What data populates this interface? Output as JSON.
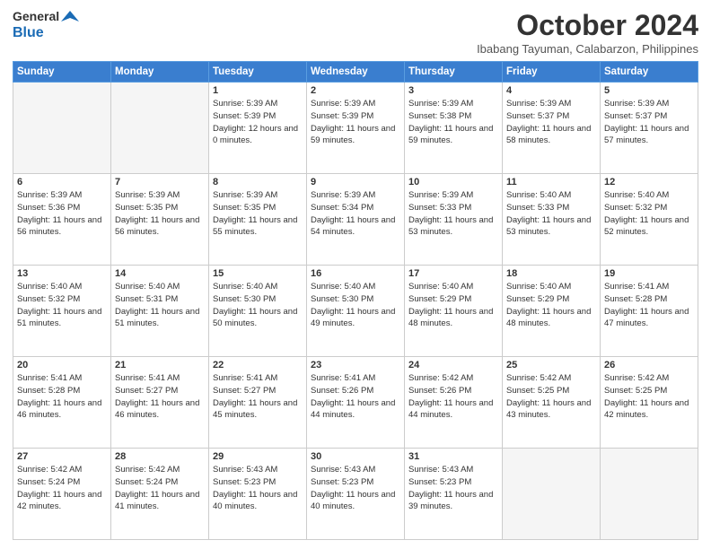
{
  "header": {
    "logo_general": "General",
    "logo_blue": "Blue",
    "month_title": "October 2024",
    "location": "Ibabang Tayuman, Calabarzon, Philippines"
  },
  "days_of_week": [
    "Sunday",
    "Monday",
    "Tuesday",
    "Wednesday",
    "Thursday",
    "Friday",
    "Saturday"
  ],
  "weeks": [
    [
      {
        "day": "",
        "sunrise": "",
        "sunset": "",
        "daylight": ""
      },
      {
        "day": "",
        "sunrise": "",
        "sunset": "",
        "daylight": ""
      },
      {
        "day": "1",
        "sunrise": "Sunrise: 5:39 AM",
        "sunset": "Sunset: 5:39 PM",
        "daylight": "Daylight: 12 hours and 0 minutes."
      },
      {
        "day": "2",
        "sunrise": "Sunrise: 5:39 AM",
        "sunset": "Sunset: 5:39 PM",
        "daylight": "Daylight: 11 hours and 59 minutes."
      },
      {
        "day": "3",
        "sunrise": "Sunrise: 5:39 AM",
        "sunset": "Sunset: 5:38 PM",
        "daylight": "Daylight: 11 hours and 59 minutes."
      },
      {
        "day": "4",
        "sunrise": "Sunrise: 5:39 AM",
        "sunset": "Sunset: 5:37 PM",
        "daylight": "Daylight: 11 hours and 58 minutes."
      },
      {
        "day": "5",
        "sunrise": "Sunrise: 5:39 AM",
        "sunset": "Sunset: 5:37 PM",
        "daylight": "Daylight: 11 hours and 57 minutes."
      }
    ],
    [
      {
        "day": "6",
        "sunrise": "Sunrise: 5:39 AM",
        "sunset": "Sunset: 5:36 PM",
        "daylight": "Daylight: 11 hours and 56 minutes."
      },
      {
        "day": "7",
        "sunrise": "Sunrise: 5:39 AM",
        "sunset": "Sunset: 5:35 PM",
        "daylight": "Daylight: 11 hours and 56 minutes."
      },
      {
        "day": "8",
        "sunrise": "Sunrise: 5:39 AM",
        "sunset": "Sunset: 5:35 PM",
        "daylight": "Daylight: 11 hours and 55 minutes."
      },
      {
        "day": "9",
        "sunrise": "Sunrise: 5:39 AM",
        "sunset": "Sunset: 5:34 PM",
        "daylight": "Daylight: 11 hours and 54 minutes."
      },
      {
        "day": "10",
        "sunrise": "Sunrise: 5:39 AM",
        "sunset": "Sunset: 5:33 PM",
        "daylight": "Daylight: 11 hours and 53 minutes."
      },
      {
        "day": "11",
        "sunrise": "Sunrise: 5:40 AM",
        "sunset": "Sunset: 5:33 PM",
        "daylight": "Daylight: 11 hours and 53 minutes."
      },
      {
        "day": "12",
        "sunrise": "Sunrise: 5:40 AM",
        "sunset": "Sunset: 5:32 PM",
        "daylight": "Daylight: 11 hours and 52 minutes."
      }
    ],
    [
      {
        "day": "13",
        "sunrise": "Sunrise: 5:40 AM",
        "sunset": "Sunset: 5:32 PM",
        "daylight": "Daylight: 11 hours and 51 minutes."
      },
      {
        "day": "14",
        "sunrise": "Sunrise: 5:40 AM",
        "sunset": "Sunset: 5:31 PM",
        "daylight": "Daylight: 11 hours and 51 minutes."
      },
      {
        "day": "15",
        "sunrise": "Sunrise: 5:40 AM",
        "sunset": "Sunset: 5:30 PM",
        "daylight": "Daylight: 11 hours and 50 minutes."
      },
      {
        "day": "16",
        "sunrise": "Sunrise: 5:40 AM",
        "sunset": "Sunset: 5:30 PM",
        "daylight": "Daylight: 11 hours and 49 minutes."
      },
      {
        "day": "17",
        "sunrise": "Sunrise: 5:40 AM",
        "sunset": "Sunset: 5:29 PM",
        "daylight": "Daylight: 11 hours and 48 minutes."
      },
      {
        "day": "18",
        "sunrise": "Sunrise: 5:40 AM",
        "sunset": "Sunset: 5:29 PM",
        "daylight": "Daylight: 11 hours and 48 minutes."
      },
      {
        "day": "19",
        "sunrise": "Sunrise: 5:41 AM",
        "sunset": "Sunset: 5:28 PM",
        "daylight": "Daylight: 11 hours and 47 minutes."
      }
    ],
    [
      {
        "day": "20",
        "sunrise": "Sunrise: 5:41 AM",
        "sunset": "Sunset: 5:28 PM",
        "daylight": "Daylight: 11 hours and 46 minutes."
      },
      {
        "day": "21",
        "sunrise": "Sunrise: 5:41 AM",
        "sunset": "Sunset: 5:27 PM",
        "daylight": "Daylight: 11 hours and 46 minutes."
      },
      {
        "day": "22",
        "sunrise": "Sunrise: 5:41 AM",
        "sunset": "Sunset: 5:27 PM",
        "daylight": "Daylight: 11 hours and 45 minutes."
      },
      {
        "day": "23",
        "sunrise": "Sunrise: 5:41 AM",
        "sunset": "Sunset: 5:26 PM",
        "daylight": "Daylight: 11 hours and 44 minutes."
      },
      {
        "day": "24",
        "sunrise": "Sunrise: 5:42 AM",
        "sunset": "Sunset: 5:26 PM",
        "daylight": "Daylight: 11 hours and 44 minutes."
      },
      {
        "day": "25",
        "sunrise": "Sunrise: 5:42 AM",
        "sunset": "Sunset: 5:25 PM",
        "daylight": "Daylight: 11 hours and 43 minutes."
      },
      {
        "day": "26",
        "sunrise": "Sunrise: 5:42 AM",
        "sunset": "Sunset: 5:25 PM",
        "daylight": "Daylight: 11 hours and 42 minutes."
      }
    ],
    [
      {
        "day": "27",
        "sunrise": "Sunrise: 5:42 AM",
        "sunset": "Sunset: 5:24 PM",
        "daylight": "Daylight: 11 hours and 42 minutes."
      },
      {
        "day": "28",
        "sunrise": "Sunrise: 5:42 AM",
        "sunset": "Sunset: 5:24 PM",
        "daylight": "Daylight: 11 hours and 41 minutes."
      },
      {
        "day": "29",
        "sunrise": "Sunrise: 5:43 AM",
        "sunset": "Sunset: 5:23 PM",
        "daylight": "Daylight: 11 hours and 40 minutes."
      },
      {
        "day": "30",
        "sunrise": "Sunrise: 5:43 AM",
        "sunset": "Sunset: 5:23 PM",
        "daylight": "Daylight: 11 hours and 40 minutes."
      },
      {
        "day": "31",
        "sunrise": "Sunrise: 5:43 AM",
        "sunset": "Sunset: 5:23 PM",
        "daylight": "Daylight: 11 hours and 39 minutes."
      },
      {
        "day": "",
        "sunrise": "",
        "sunset": "",
        "daylight": ""
      },
      {
        "day": "",
        "sunrise": "",
        "sunset": "",
        "daylight": ""
      }
    ]
  ]
}
